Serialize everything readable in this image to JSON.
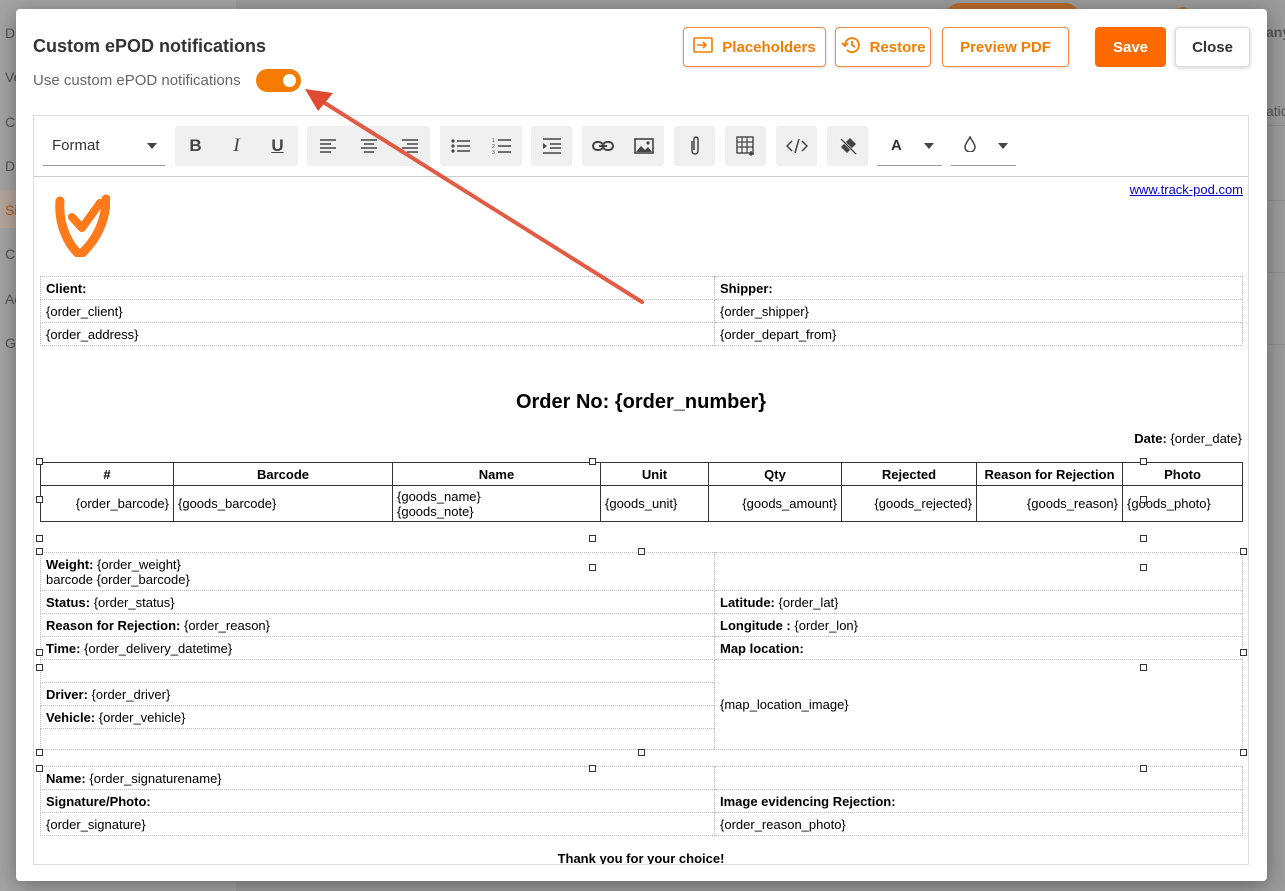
{
  "background": {
    "sidebar_items": [
      "D",
      "Ve",
      "C",
      "D",
      "Si",
      "C",
      "Ac",
      "G"
    ],
    "right_texts": [
      "any",
      "atio"
    ]
  },
  "modal": {
    "title": "Custom ePOD notifications",
    "toggle_label": "Use custom ePOD notifications",
    "toggle_on": true,
    "buttons": {
      "placeholders": "Placeholders",
      "restore": "Restore",
      "preview_pdf": "Preview PDF",
      "save": "Save",
      "close": "Close"
    },
    "accent_color": "#ff6a00"
  },
  "toolbar": {
    "format_label": "Format",
    "text_color_label": "A",
    "icons": [
      "bold-icon",
      "italic-icon",
      "underline-icon",
      "align-left-icon",
      "align-center-icon",
      "align-right-icon",
      "bullet-list-icon",
      "numbered-list-icon",
      "indent-icon",
      "link-icon",
      "image-icon",
      "attachment-icon",
      "table-icon",
      "code-icon",
      "clear-format-icon",
      "text-color-icon",
      "highlight-icon"
    ]
  },
  "document": {
    "website_link": "www.track-pod.com",
    "header_table": {
      "client_label": "Client:",
      "shipper_label": "Shipper:",
      "order_client": "{order_client}",
      "order_shipper": "{order_shipper}",
      "order_address": "{order_address}",
      "order_depart_from": "{order_depart_from}"
    },
    "order_title": "Order No: {order_number}",
    "date_label": "Date:",
    "date_value": "{order_date}",
    "goods_table": {
      "headers": [
        "#",
        "Barcode",
        "Name",
        "Unit",
        "Qty",
        "Rejected",
        "Reason for Rejection",
        "Photo"
      ],
      "row": {
        "num": "{order_barcode}",
        "barcode": "{goods_barcode}",
        "name": "{goods_name}",
        "note": "{goods_note}",
        "unit": "{goods_unit}",
        "qty": "{goods_amount}",
        "rejected": "{goods_rejected}",
        "reason": "{goods_reason}",
        "photo": "{goods_photo}"
      }
    },
    "details": {
      "weight_label": "Weight:",
      "weight_value": "{order_weight}",
      "barcode_line": "barcode {order_barcode}",
      "status_label": "Status:",
      "status_value": "{order_status}",
      "latitude_label": "Latitude:",
      "latitude_value": "{order_lat}",
      "reason_label": "Reason for Rejection:",
      "reason_value": "{order_reason}",
      "longitude_label": "Longitude :",
      "longitude_value": "{order_lon}",
      "time_label": "Time:",
      "time_value": "{order_delivery_datetime}",
      "map_label": "Map location:",
      "driver_label": "Driver:",
      "driver_value": "{order_driver}",
      "vehicle_label": "Vehicle:",
      "vehicle_value": "{order_vehicle}",
      "map_image": "{map_location_image}"
    },
    "signature": {
      "name_label": "Name:",
      "name_value": "{order_signaturename}",
      "sig_label": "Signature/Photo:",
      "img_rej_label": "Image evidencing Rejection:",
      "sig_value": "{order_signature}",
      "reason_photo": "{order_reason_photo}"
    },
    "thank_you": "Thank you for your choice!"
  }
}
